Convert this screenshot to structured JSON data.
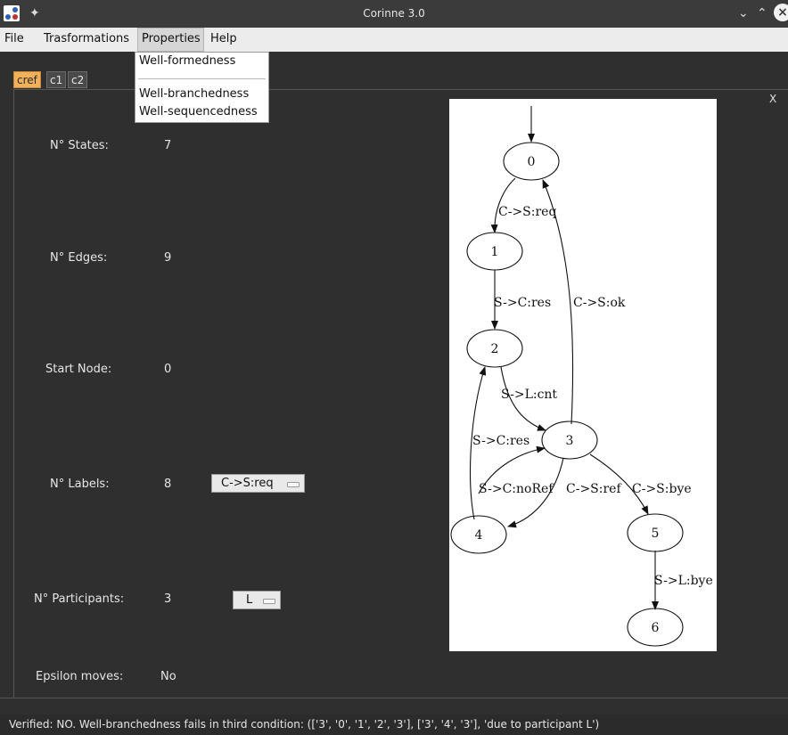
{
  "window": {
    "title": "Corinne 3.0",
    "icons": {
      "app": "corinne-app-icon",
      "pin": "pin-icon",
      "minimize": "chevron-down-icon",
      "maximize": "chevron-up-icon",
      "close": "close-icon"
    }
  },
  "menubar": {
    "items": [
      "File",
      "Trasformations",
      "Properties",
      "Help"
    ],
    "active": "Properties"
  },
  "properties_menu": {
    "items": [
      "Well-formedness",
      "Well-branchedness",
      "Well-sequencedness"
    ]
  },
  "tabs": {
    "items": [
      "cref",
      "c1",
      "c2"
    ],
    "active": "cref"
  },
  "panel": {
    "close_label": "X"
  },
  "stats": {
    "states": {
      "label": "N° States:",
      "value": "7"
    },
    "edges": {
      "label": "N° Edges:",
      "value": "9"
    },
    "start_node": {
      "label": "Start Node:",
      "value": "0"
    },
    "labels": {
      "label": "N° Labels:",
      "value": "8",
      "selected": "C->S:req"
    },
    "participants": {
      "label": "N° Participants:",
      "value": "3",
      "selected": "L"
    },
    "epsilon": {
      "label": "Epsilon moves:",
      "value": "No"
    }
  },
  "graph": {
    "nodes": [
      "0",
      "1",
      "2",
      "3",
      "4",
      "5",
      "6"
    ],
    "edge_labels": [
      "C->S:req",
      "S->C:res",
      "C->S:ok",
      "S->L:cnt",
      "S->C:res",
      "S->C:noRef",
      "C->S:ref",
      "C->S:bye",
      "S->L:bye"
    ]
  },
  "status": {
    "text": "Verified: NO. Well-branchedness fails in third condition: (['3', '0', '1', '2', '3'], ['3', '4', '3'], 'due to participant L')"
  },
  "colors": {
    "active_tab": "#f0b15a",
    "background": "#2f2f2f",
    "menubar": "#ececec"
  }
}
